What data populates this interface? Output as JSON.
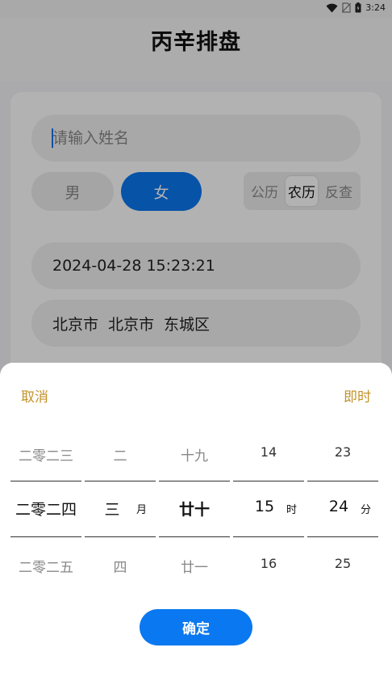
{
  "status_bar": {
    "time": "3:24"
  },
  "header": {
    "title": "丙辛排盘"
  },
  "form": {
    "name_placeholder": "请输入姓名",
    "gender": {
      "male": "男",
      "female": "女",
      "selected": "女"
    },
    "calendar": {
      "options": [
        "公历",
        "农历",
        "反查"
      ],
      "selected": "农历"
    },
    "datetime": "2024-04-28 15:23:21",
    "location": [
      "北京市",
      "北京市",
      "东城区"
    ]
  },
  "picker": {
    "cancel": "取消",
    "now": "即时",
    "columns": [
      {
        "above": "二零二三",
        "selected": "二零二四",
        "below": "二零二五",
        "unit": ""
      },
      {
        "above": "二",
        "selected": "三",
        "below": "四",
        "unit": "月"
      },
      {
        "above": "十九",
        "selected": "廿十",
        "below": "廿一",
        "unit": ""
      },
      {
        "above": "14",
        "selected": "15",
        "below": "16",
        "unit": "时"
      },
      {
        "above": "23",
        "selected": "24",
        "below": "25",
        "unit": "分"
      }
    ],
    "confirm": "确定"
  },
  "colors": {
    "accent": "#0a78f0",
    "action_text": "#c4922a"
  }
}
